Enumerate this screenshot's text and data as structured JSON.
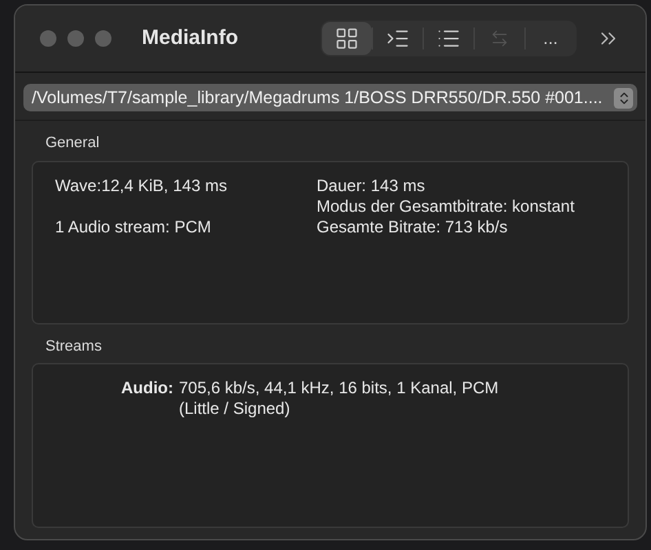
{
  "window": {
    "title": "MediaInfo"
  },
  "toolbar": {
    "segments": [
      {
        "kind": "grid",
        "selected": true,
        "disabled": false
      },
      {
        "kind": "outline",
        "selected": false,
        "disabled": false
      },
      {
        "kind": "list",
        "selected": false,
        "disabled": false
      },
      {
        "kind": "swap",
        "selected": false,
        "disabled": true
      },
      {
        "kind": "text",
        "label": "...",
        "selected": false,
        "disabled": false
      }
    ]
  },
  "file_picker": {
    "value": "/Volumes/T7/sample_library/Megadrums 1/BOSS DRR550/DR.550 #001...."
  },
  "general": {
    "title": "General",
    "rows": [
      {
        "left": "Wave:12,4 KiB, 143 ms",
        "right": "Dauer: 143 ms"
      },
      {
        "right": "Modus der Gesamtbitrate: konstant"
      },
      {
        "left": "1 Audio stream: PCM",
        "right": "Gesamte Bitrate: 713 kb/s"
      }
    ]
  },
  "streams": {
    "title": "Streams",
    "items": [
      {
        "label": "Audio:",
        "lines": [
          "705,6 kb/s, 44,1 kHz, 16 bits, 1 Kanal, PCM",
          "(Little / Signed)"
        ]
      }
    ]
  }
}
